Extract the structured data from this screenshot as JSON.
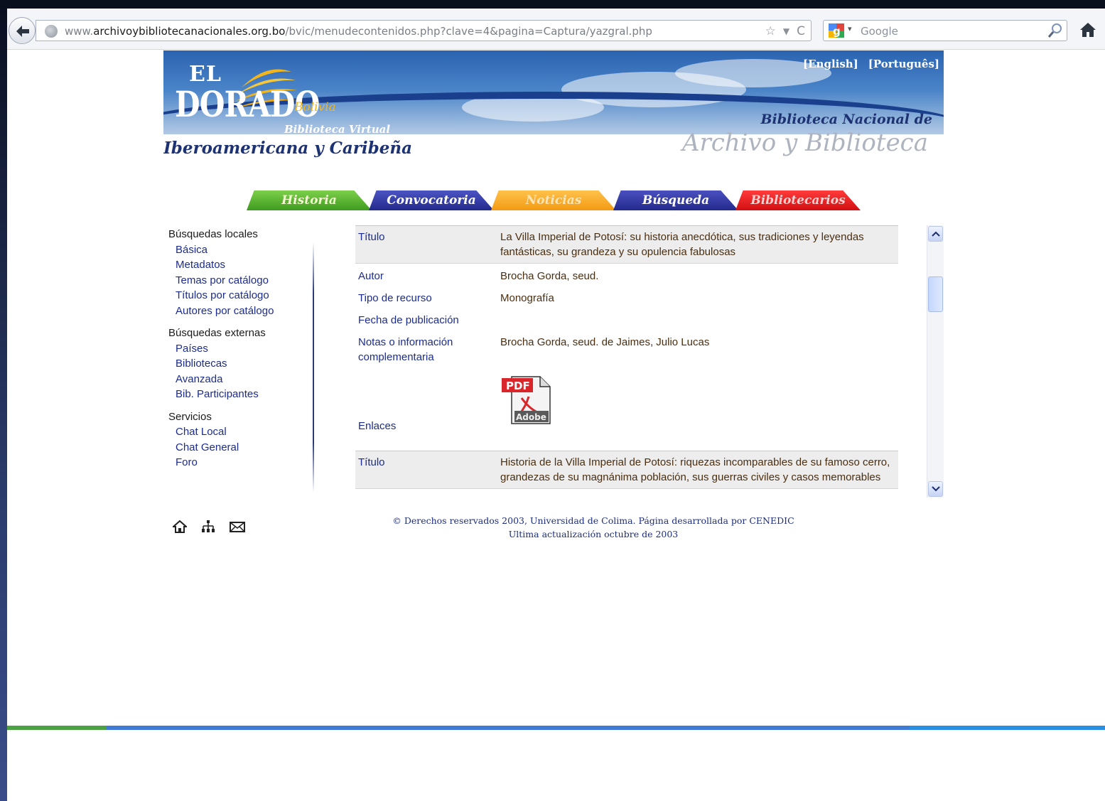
{
  "browser": {
    "url_prefix": "www.",
    "url_domain": "archivoybibliotecanacionales.org.bo",
    "url_path": "/bvic/menudecontenidos.php?clave=4&pagina=Captura/yazgral.php",
    "search_placeholder": "Google"
  },
  "banner": {
    "logo_el": "EL",
    "logo_dorado": "DORADO",
    "logo_bolivia": "Bolivia",
    "logo_bv": "Biblioteca Virtual",
    "logo_ibero": "Iberoamericana y Caribeña",
    "lang_english": "[English]",
    "lang_portugues": "[Português]",
    "right_line1": "Biblioteca Nacional de",
    "right_line2": "Archivo y Biblioteca"
  },
  "tabs": [
    "Historia",
    "Convocatoria",
    "Noticias",
    "Búsqueda",
    "Bibliotecarios"
  ],
  "leftnav": {
    "groups": [
      {
        "head": "Búsquedas locales",
        "links": [
          "Básica",
          "Metadatos",
          "Temas por catálogo",
          "Títulos por catálogo",
          "Autores por catálogo"
        ]
      },
      {
        "head": "Búsquedas externas",
        "links": [
          "Países",
          "Bibliotecas",
          "Avanzada",
          "Bib. Participantes"
        ]
      },
      {
        "head": "Servicios",
        "links": [
          "Chat Local",
          "Chat General",
          "Foro"
        ]
      }
    ]
  },
  "record1": {
    "titulo_label": "Título",
    "titulo_value": "La Villa Imperial de Potosí: su historia anecdótica, sus tradiciones y leyendas fantásticas, su grandeza y su opulencia fabulosas",
    "autor_label": "Autor",
    "autor_value": "Brocha Gorda, seud.",
    "tipo_label": "Tipo de recurso",
    "tipo_value": "Monografía",
    "fecha_label": "Fecha de publicación",
    "fecha_value": "",
    "notas_label": "Notas o información complementaria",
    "notas_value": "Brocha Gorda, seud. de Jaimes, Julio Lucas",
    "enlaces_label": "Enlaces",
    "pdf_top": "PDF",
    "pdf_bottom": "Adobe"
  },
  "record2": {
    "titulo_label": "Título",
    "titulo_value": "Historia de la Villa Imperial de Potosí: riquezas incomparables de su famoso cerro, grandezas de su magnánima población, sus guerras civiles y casos memorables"
  },
  "footer": {
    "line1": "© Derechos reservados 2003, Universidad de Colima. Página desarrollada por CENEDIC",
    "line2": "Ultima actualización octubre de 2003"
  }
}
